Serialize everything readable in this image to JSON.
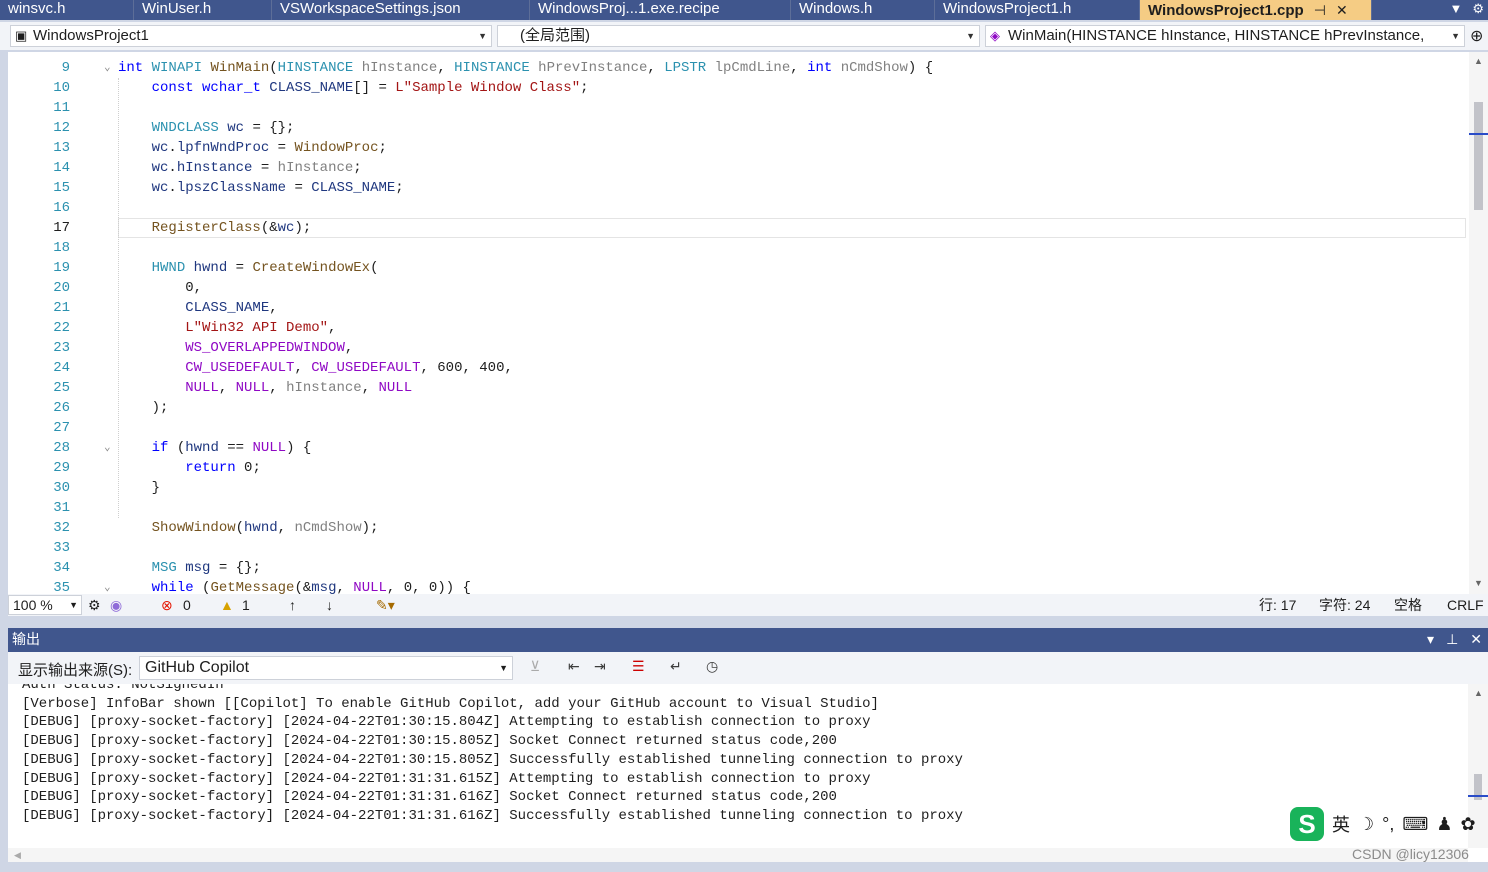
{
  "tabs": [
    {
      "label": "winsvc.h"
    },
    {
      "label": "WinUser.h"
    },
    {
      "label": "VSWorkspaceSettings.json"
    },
    {
      "label": "WindowsProj...1.exe.recipe"
    },
    {
      "label": "Windows.h"
    },
    {
      "label": "WindowsProject1.h"
    },
    {
      "label": "WindowsProject1.cpp",
      "pin": "⊣",
      "close": "✕"
    }
  ],
  "navbar": {
    "project": "WindowsProject1",
    "scope": "(全局范围)",
    "member": "WinMain(HINSTANCE hInstance, HINSTANCE hPrevInstance,"
  },
  "editor": {
    "lines": [
      {
        "n": "9",
        "html": [
          [
            "kw",
            "int"
          ],
          [
            "tx",
            " "
          ],
          [
            "ty",
            "WINAPI"
          ],
          [
            "tx",
            " "
          ],
          [
            "fn",
            "WinMain"
          ],
          [
            "tx",
            "("
          ],
          [
            "ty",
            "HINSTANCE"
          ],
          [
            "tx",
            " "
          ],
          [
            "pa",
            "hInstance"
          ],
          [
            "tx",
            ", "
          ],
          [
            "ty",
            "HINSTANCE"
          ],
          [
            "tx",
            " "
          ],
          [
            "pa",
            "hPrevInstance"
          ],
          [
            "tx",
            ", "
          ],
          [
            "ty",
            "LPSTR"
          ],
          [
            "tx",
            " "
          ],
          [
            "pa",
            "lpCmdLine"
          ],
          [
            "tx",
            ", "
          ],
          [
            "kw",
            "int"
          ],
          [
            "tx",
            " "
          ],
          [
            "pa",
            "nCmdShow"
          ],
          [
            "tx",
            ") {"
          ]
        ]
      },
      {
        "n": "10",
        "html": [
          [
            "tx",
            "    "
          ],
          [
            "kw",
            "const"
          ],
          [
            "tx",
            " "
          ],
          [
            "kw",
            "wchar_t"
          ],
          [
            "tx",
            " "
          ],
          [
            "vr",
            "CLASS_NAME"
          ],
          [
            "tx",
            "[] = "
          ],
          [
            "st",
            "L\"Sample Window Class\""
          ],
          [
            "tx",
            ";"
          ]
        ]
      },
      {
        "n": "11",
        "html": []
      },
      {
        "n": "12",
        "html": [
          [
            "tx",
            "    "
          ],
          [
            "ty",
            "WNDCLASS"
          ],
          [
            "tx",
            " "
          ],
          [
            "vr",
            "wc"
          ],
          [
            "tx",
            " = {};"
          ]
        ]
      },
      {
        "n": "13",
        "html": [
          [
            "tx",
            "    "
          ],
          [
            "vr",
            "wc"
          ],
          [
            "tx",
            "."
          ],
          [
            "vr",
            "lpfnWndProc"
          ],
          [
            "tx",
            " = "
          ],
          [
            "fn",
            "WindowProc"
          ],
          [
            "tx",
            ";"
          ]
        ]
      },
      {
        "n": "14",
        "html": [
          [
            "tx",
            "    "
          ],
          [
            "vr",
            "wc"
          ],
          [
            "tx",
            "."
          ],
          [
            "vr",
            "hInstance"
          ],
          [
            "tx",
            " = "
          ],
          [
            "pa",
            "hInstance"
          ],
          [
            "tx",
            ";"
          ]
        ]
      },
      {
        "n": "15",
        "html": [
          [
            "tx",
            "    "
          ],
          [
            "vr",
            "wc"
          ],
          [
            "tx",
            "."
          ],
          [
            "vr",
            "lpszClassName"
          ],
          [
            "tx",
            " = "
          ],
          [
            "vr",
            "CLASS_NAME"
          ],
          [
            "tx",
            ";"
          ]
        ]
      },
      {
        "n": "16",
        "html": []
      },
      {
        "n": "17",
        "html": [
          [
            "tx",
            "    "
          ],
          [
            "fn",
            "RegisterClass"
          ],
          [
            "tx",
            "(&"
          ],
          [
            "vr",
            "wc"
          ],
          [
            "tx",
            ");"
          ]
        ]
      },
      {
        "n": "18",
        "html": []
      },
      {
        "n": "19",
        "html": [
          [
            "tx",
            "    "
          ],
          [
            "ty",
            "HWND"
          ],
          [
            "tx",
            " "
          ],
          [
            "vr",
            "hwnd"
          ],
          [
            "tx",
            " = "
          ],
          [
            "fn",
            "CreateWindowEx"
          ],
          [
            "tx",
            "("
          ]
        ]
      },
      {
        "n": "20",
        "html": [
          [
            "tx",
            "        0,"
          ]
        ]
      },
      {
        "n": "21",
        "html": [
          [
            "tx",
            "        "
          ],
          [
            "vr",
            "CLASS_NAME"
          ],
          [
            "tx",
            ","
          ]
        ]
      },
      {
        "n": "22",
        "html": [
          [
            "tx",
            "        "
          ],
          [
            "st",
            "L\"Win32 API Demo\""
          ],
          [
            "tx",
            ","
          ]
        ]
      },
      {
        "n": "23",
        "html": [
          [
            "tx",
            "        "
          ],
          [
            "mc",
            "WS_OVERLAPPEDWINDOW"
          ],
          [
            "tx",
            ","
          ]
        ]
      },
      {
        "n": "24",
        "html": [
          [
            "tx",
            "        "
          ],
          [
            "mc",
            "CW_USEDEFAULT"
          ],
          [
            "tx",
            ", "
          ],
          [
            "mc",
            "CW_USEDEFAULT"
          ],
          [
            "tx",
            ", 600, 400,"
          ]
        ]
      },
      {
        "n": "25",
        "html": [
          [
            "tx",
            "        "
          ],
          [
            "mc",
            "NULL"
          ],
          [
            "tx",
            ", "
          ],
          [
            "mc",
            "NULL"
          ],
          [
            "tx",
            ", "
          ],
          [
            "pa",
            "hInstance"
          ],
          [
            "tx",
            ", "
          ],
          [
            "mc",
            "NULL"
          ]
        ]
      },
      {
        "n": "26",
        "html": [
          [
            "tx",
            "    );"
          ]
        ]
      },
      {
        "n": "27",
        "html": []
      },
      {
        "n": "28",
        "html": [
          [
            "tx",
            "    "
          ],
          [
            "kw",
            "if"
          ],
          [
            "tx",
            " ("
          ],
          [
            "vr",
            "hwnd"
          ],
          [
            "tx",
            " == "
          ],
          [
            "mc",
            "NULL"
          ],
          [
            "tx",
            ") {"
          ]
        ]
      },
      {
        "n": "29",
        "html": [
          [
            "tx",
            "        "
          ],
          [
            "kw",
            "return"
          ],
          [
            "tx",
            " 0;"
          ]
        ]
      },
      {
        "n": "30",
        "html": [
          [
            "tx",
            "    }"
          ]
        ]
      },
      {
        "n": "31",
        "html": []
      },
      {
        "n": "32",
        "html": [
          [
            "tx",
            "    "
          ],
          [
            "fn",
            "ShowWindow"
          ],
          [
            "tx",
            "("
          ],
          [
            "vr",
            "hwnd"
          ],
          [
            "tx",
            ", "
          ],
          [
            "pa",
            "nCmdShow"
          ],
          [
            "tx",
            ");"
          ]
        ]
      },
      {
        "n": "33",
        "html": []
      },
      {
        "n": "34",
        "html": [
          [
            "tx",
            "    "
          ],
          [
            "ty",
            "MSG"
          ],
          [
            "tx",
            " "
          ],
          [
            "vr",
            "msg"
          ],
          [
            "tx",
            " = {};"
          ]
        ]
      },
      {
        "n": "35",
        "html": [
          [
            "tx",
            "    "
          ],
          [
            "kw",
            "while"
          ],
          [
            "tx",
            " ("
          ],
          [
            "fn",
            "GetMessage"
          ],
          [
            "tx",
            "(&"
          ],
          [
            "vr",
            "msg"
          ],
          [
            "tx",
            ", "
          ],
          [
            "mc",
            "NULL"
          ],
          [
            "tx",
            ", 0, 0)) {"
          ]
        ]
      }
    ],
    "current_line": "17"
  },
  "status": {
    "zoom": "100 %",
    "errors": "0",
    "warnings": "1",
    "row": "行: 17",
    "col": "字符: 24",
    "spaces": "空格",
    "eol": "CRLF"
  },
  "output": {
    "title": "输出",
    "source_label": "显示输出来源(S):",
    "source_value": "GitHub Copilot",
    "lines": [
      "Auth Status: NotSignedIn",
      "[Verbose] InfoBar shown [[Copilot] To enable GitHub Copilot, add your GitHub account to Visual Studio]",
      "[DEBUG] [proxy-socket-factory] [2024-04-22T01:30:15.804Z] Attempting to establish connection to proxy",
      "[DEBUG] [proxy-socket-factory] [2024-04-22T01:30:15.805Z] Socket Connect returned status code,200",
      "[DEBUG] [proxy-socket-factory] [2024-04-22T01:30:15.805Z] Successfully established tunneling connection to proxy",
      "[DEBUG] [proxy-socket-factory] [2024-04-22T01:31:31.615Z] Attempting to establish connection to proxy",
      "[DEBUG] [proxy-socket-factory] [2024-04-22T01:31:31.616Z] Socket Connect returned status code,200",
      "[DEBUG] [proxy-socket-factory] [2024-04-22T01:31:31.616Z] Successfully established tunneling connection to proxy"
    ]
  },
  "ime": {
    "logo": "S",
    "lang": "英"
  },
  "watermark": "CSDN @licy12306"
}
